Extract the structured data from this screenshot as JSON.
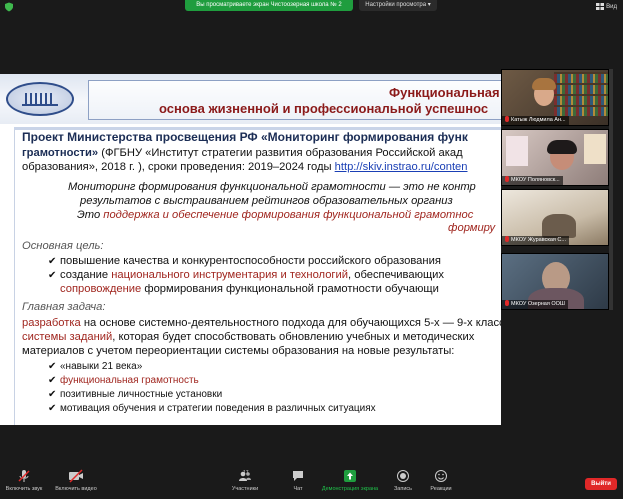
{
  "topbar": {
    "share_notice": "Вы просматриваете экран Чистоозерная школа № 2",
    "view_settings": "Настройки просмотра",
    "view_label": "Вид",
    "accent_green": "#1f9d3e"
  },
  "slide": {
    "title_line1": "Функциональная",
    "title_line2": "основа жизненной и профессиональной успешнос",
    "project_line1": "Проект Министерства просвещения РФ «Мониторинг формирования функ",
    "project_line2_bold": "грамотности»",
    "project_line2_rest": " (ФГБНУ «Институт стратегии развития образования Российской акад",
    "project_line3": "образования», 2018 г. ), сроки проведения: 2019–2024 годы ",
    "project_link": "http://skiv.instrao.ru/conten",
    "quote_line1": "Мониторинг формирования функциональной грамотности — это не контр",
    "quote_line2": "результатов с выстраиванием рейтингов образовательных организ",
    "quote_line3_a": "Это ",
    "quote_line3_b": "поддержка и обеспечение формирования функциональной грамотнос",
    "quote_line4": "формиру",
    "goal_heading": "Основная цель:",
    "goal_item1": "повышение качества и конкурентоспособности российского образования",
    "goal_item2_a": "создание ",
    "goal_item2_b": "национального инструментария и технологий",
    "goal_item2_c": ", обеспечивающих",
    "goal_item3_a": "сопровождение",
    "goal_item3_b": " формирования функциональной грамотности обучающи",
    "task_heading": "Главная задача:",
    "task_line1_a": "разработка",
    "task_line1_b": " на основе системно-деятельностного подхода для обучающихся 5-х — 9-х классов",
    "task_line2_a": "системы заданий",
    "task_line2_b": ", которая будет способствовать обновлению учебных и методических",
    "task_line3": "материалов с учетом переориентации системы образования на новые результаты:",
    "result_item1": "«навыки 21 века»",
    "result_item2": "функциональная грамотность",
    "result_item3": "позитивные личностные установки",
    "result_item4": "мотивация обучения и стратегии поведения в различных ситуациях"
  },
  "participants": [
    {
      "name": "Катыж Людмила Ан..."
    },
    {
      "name": "МКОУ Поляновск..."
    },
    {
      "name": "МКОУ Журавская С..."
    },
    {
      "name": "МКОУ Озерная ООШ"
    }
  ],
  "toolbar": {
    "unmute": "Включить звук",
    "start_video": "Включить видео",
    "participants": "Участники",
    "participants_count": "17",
    "chat": "Чат",
    "share_screen": "Демонстрация экрана",
    "record": "Запись",
    "reactions": "Реакции",
    "end": "Выйти",
    "end_color": "#e02828"
  }
}
